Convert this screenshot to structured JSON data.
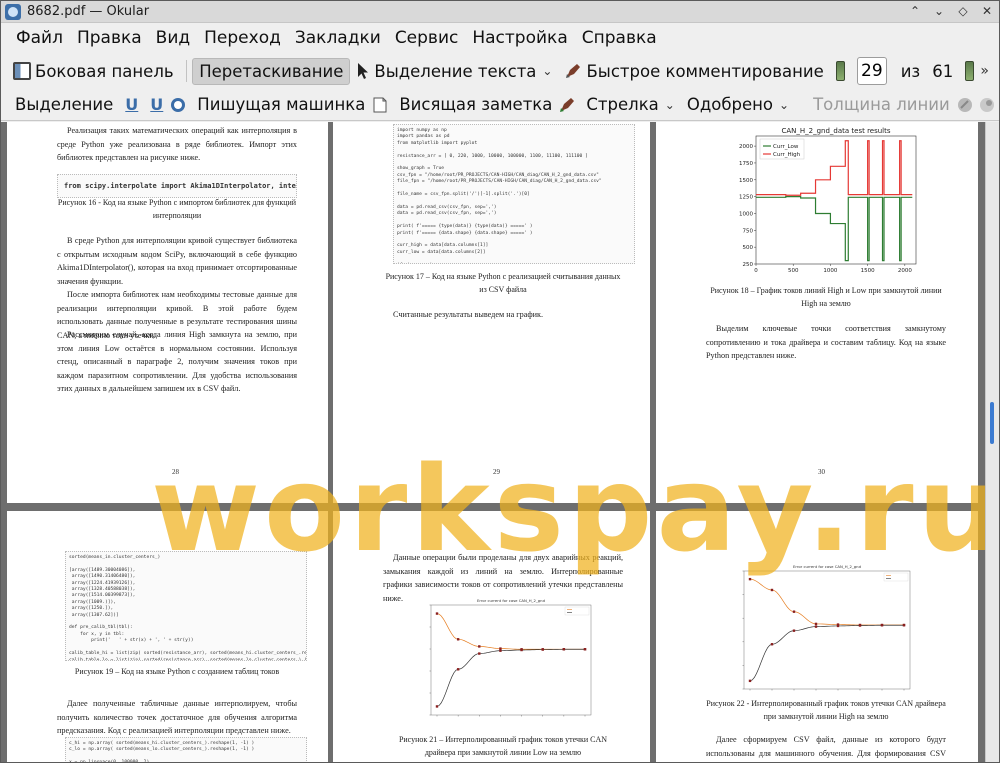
{
  "window": {
    "title": "8682.pdf — Okular"
  },
  "menu": [
    "Файл",
    "Правка",
    "Вид",
    "Переход",
    "Закладки",
    "Сервис",
    "Настройка",
    "Справка"
  ],
  "toolbar": {
    "sidebar": "Боковая панель",
    "browse": "Перетаскивание",
    "text_select": "Выделение текста",
    "quick_annot": "Быстрое комментирование",
    "page_current": "29",
    "page_of": "из",
    "page_total": "61"
  },
  "annot_toolbar": {
    "highlight": "Выделение",
    "typewriter": "Пишущая машинка",
    "note": "Висящая заметка",
    "arrow": "Стрелка",
    "approved": "Одобрено",
    "line_width": "Толщина линии"
  },
  "watermark": "workspay.ru",
  "pages": {
    "p28": {
      "para1": "Реализация таких математических операций как интерполяция в среде Python уже реализована в ряде библиотек. Импорт этих библиотек представлен на рисунке ниже.",
      "code": "from scipy.interpolate import Akima1DInterpolator, interp1d",
      "caption": "Рисунок 16 - Код на языке Python с импортом библиотек для функций интерполяции",
      "para2": "В среде Python для интерполяции кривой существует библиотека с открытым исходным кодом SciPy, включающий в себе функцию Akima1DInterpolator(), которая на вход принимает отсортированные значения функции.",
      "para3": "После импорта библиотек нам необходимы тестовые данные для реализации интерполяции кривой. В этой работе будем использовать данные полученные в результате тестирования шины CAN, а именно токи утечки.",
      "para4": "Рассмотрим случай, когда линия High замкнута на землю, при этом линия Low остаётся в нормальном состоянии. Используя стенд, описанный в параграфе 2, получим значения токов при каждом паразитном сопротивлении. Для удобства использования этих данных в дальнейшем запишем их в CSV файл.",
      "num": "28"
    },
    "p29": {
      "code": "import numpy as np\nimport pandas as pd\nfrom matplotlib import pyplot\n\nresistance_arr = [ 0, 220, 1000, 10000, 100000, 1100, 11100, 111100 ]\n\nshow_graph = True\ncsv_fpn = \"/home/root/PR_PROJECTS/CAN-HIGH/CAN_diag/CAN_H_2_gnd_data.csv\"\nfile_fpn = \"/home/root/PR_PROJECTS/CAN-HIGH/CAN_diag/CAN_H_2_gnd_data.csv\"\n\nfile_name = csv_fpn.split('/')[-1].split('.')[0]\n\ndata = pd.read_csv(csv_fpn, sep=',')\ndata = pd.read_csv(csv_fpn, sep=',')\n\nprint( f'===== {type(data)} {type(data)} =====' )\nprint( f'===== {data.shape} {data.shape} =====' )\n\ncurr_high = data[data.columns[1]]\ncurr_low = data[data.columns[2]]\n\nif show_graph:\n    pyplot.title( f'{file_name} test results' )\n    pyplot.plot(data.index, curr_low, 'g-', label='Curr_Low')\n    pyplot.plot(data.index, curr_high, 'r-', label='Curr_High')\n    pyplot.legend()\n    pyplot.show()\n\ndata.columns",
      "caption": "Рисунок 17 – Код на языке Python с реализацией считывания данных из CSV файла",
      "para1": "Считанные результаты выведем на график.",
      "num": "29"
    },
    "p30": {
      "caption": "Рисунок 18 – График токов линий High и Low при замкнутой линии High на землю",
      "para1": "Выделим ключевые точки соответствия замкнутому сопротивлению и тока драйвера и составим таблицу. Код на языке Python представлен ниже.",
      "num": "30"
    },
    "p31": {
      "code": "sorted(means_in.cluster_centers_)\n\n[array([1489.30004086]),\n array([1490.31406480]),\n array([1224.41939126]),\n array([1328.40588038]),\n array([1514.00399873]),\n array([1009.)]),\n array([1250.]),\n array([1307.62])]\n\ndef pre_calib_tbl(tbl):\n    for x, y in tbl:\n        print('   ' + str(x) + ', ' + str(y))\n\ncalib_table_hi = list(zip( sorted(resistance_arr), sorted(means_hi.cluster_centers_.reshape(-1)) ))\ncalib_table_lo = list(zip( sorted(resistance_arr), sorted(means_lo.cluster_centers_) ))\nprint( f'{file_name}:' )\n\nprint( f'===== calib_table_hi ===== {len(calib_table_hi)}' )\npre_calib_tbl(calib_table_hi)\nprint( f'===== calib_table_lo ===== {len(calib_table_lo)}' )\npre_calib_tbl(calib_table_lo)",
      "caption": "Рисунок 19 – Код на языке Python с созданием таблиц токов",
      "para1": "Далее полученные табличные данные интерполируем, чтобы получить количество точек достаточное для обучения алгоритма предсказания. Код с реализацией интерполяции представлен ниже.",
      "code2": "c_hi = np.array( sorted(means_hi.cluster_centers_).reshape(1, -1) )\nc_lo = np.array( sorted(means_lo.cluster_centers_).reshape(1, -1) )\n\nx = np.linspace(0, 100000, 2)"
    },
    "p32": {
      "para1": "Данные операции были проделаны для двух аварийных реакций, замыкания каждой из линий на землю. Интерполированные графики зависимости токов от сопротивлений утечки представлены ниже.",
      "chart_title": "Error current for case CAN_H_2_gnd",
      "caption": "Рисунок 21 – Интерполированный график токов утечки CAN драйвера при замкнутой линии Low на землю"
    },
    "p33": {
      "chart_title": "Error current for case CAN_H_2_gnd",
      "caption": "Рисунок 22 - Интерполированный график токов утечки CAN драйвера при замкнутой линии High на землю",
      "para1": "Далее сформируем CSV файл, данные из которого будут использованы для машинного обучения. Для формирования CSV файла будем использовать"
    }
  },
  "chart_data": [
    {
      "type": "line",
      "title": "CAN_H_2_gnd_data test results",
      "x_ticks": [
        "0",
        "500",
        "1000",
        "1500",
        "2000"
      ],
      "y_ticks": [
        "250",
        "500",
        "750",
        "1000",
        "1250",
        "1500",
        "1750",
        "2000"
      ],
      "xlim": [
        0,
        2150
      ],
      "ylim": [
        250,
        2150
      ],
      "series": [
        {
          "name": "Curr_Low",
          "color": "#2e7d32",
          "x": [
            0,
            400,
            400,
            600,
            600,
            800,
            800,
            1000,
            1000,
            1200,
            1200,
            1240,
            1240,
            1500,
            1500,
            1520,
            1520,
            1700,
            1700,
            1720,
            1720,
            1930,
            1930,
            1950,
            1950,
            2100
          ],
          "y": [
            1240,
            1240,
            1250,
            1250,
            1230,
            1230,
            1000,
            1000,
            850,
            850,
            300,
            300,
            1240,
            1240,
            300,
            300,
            1240,
            1240,
            300,
            300,
            1240,
            1240,
            300,
            300,
            1240,
            1240
          ]
        },
        {
          "name": "Curr_High",
          "color": "#e53935",
          "x": [
            0,
            400,
            400,
            600,
            600,
            800,
            800,
            1000,
            1000,
            1200,
            1200,
            1240,
            1240,
            1500,
            1500,
            1520,
            1520,
            1700,
            1700,
            1720,
            1720,
            1930,
            1930,
            1950,
            1950,
            2100
          ],
          "y": [
            1280,
            1280,
            1270,
            1270,
            1300,
            1300,
            1500,
            1500,
            1700,
            1700,
            2080,
            2080,
            1280,
            1280,
            2080,
            2080,
            1280,
            1280,
            2080,
            2080,
            1280,
            1280,
            2080,
            2080,
            1280,
            1280
          ]
        }
      ],
      "legend": "top-right",
      "grid": false
    },
    {
      "type": "line",
      "title": "Error current for case CAN_H_2_gnd",
      "series": [
        {
          "name": "",
          "color": "#e67e22",
          "x": [
            0,
            1,
            2,
            3,
            4,
            5,
            6,
            7
          ],
          "y": [
            1700,
            1520,
            1470,
            1455,
            1450,
            1450,
            1450,
            1450
          ]
        },
        {
          "name": "",
          "color": "#333333",
          "x": [
            0,
            1,
            2,
            3,
            4,
            5,
            6,
            7
          ],
          "y": [
            1050,
            1310,
            1420,
            1440,
            1445,
            1448,
            1450,
            1450
          ]
        }
      ],
      "legend": "top-right",
      "grid": false
    },
    {
      "type": "line",
      "title": "Error current for case CAN_H_2_gnd",
      "series": [
        {
          "name": "",
          "color": "#e67e22",
          "x": [
            0,
            1,
            2,
            3,
            4,
            5,
            6,
            7
          ],
          "y": [
            1800,
            1720,
            1560,
            1470,
            1465,
            1462,
            1462,
            1462
          ]
        },
        {
          "name": "",
          "color": "#333333",
          "x": [
            0,
            1,
            2,
            3,
            4,
            5,
            6,
            7
          ],
          "y": [
            1050,
            1320,
            1420,
            1450,
            1455,
            1458,
            1460,
            1460
          ]
        }
      ],
      "legend": "top-right",
      "grid": false
    }
  ]
}
